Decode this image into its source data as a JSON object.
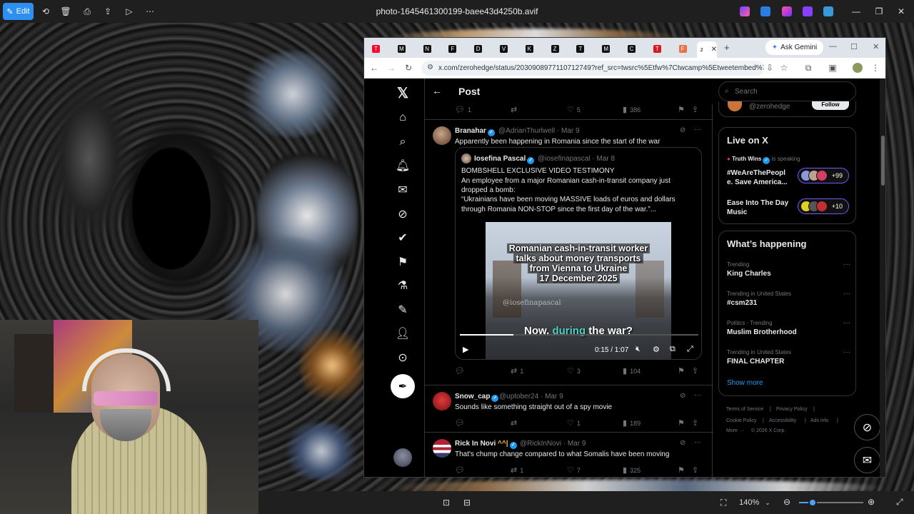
{
  "photos_app": {
    "edit_label": "Edit",
    "file_title": "photo-1645461300199-baee43d4250b.avif",
    "zoom_level": "140%"
  },
  "browser": {
    "tabs": [
      {
        "glyph": "T",
        "color": "#ff0033"
      },
      {
        "glyph": "M",
        "color": "#111111"
      },
      {
        "glyph": "N",
        "color": "#111111"
      },
      {
        "glyph": "F",
        "color": "#111111"
      },
      {
        "glyph": "D",
        "color": "#111111"
      },
      {
        "glyph": "V",
        "color": "#111111"
      },
      {
        "glyph": "K",
        "color": "#111111"
      },
      {
        "glyph": "Z",
        "color": "#111111"
      },
      {
        "glyph": "T",
        "color": "#111111"
      },
      {
        "glyph": "M",
        "color": "#111111"
      },
      {
        "glyph": "C",
        "color": "#111111"
      },
      {
        "glyph": "T",
        "color": "#d71920"
      },
      {
        "glyph": "F",
        "color": "#e8704a"
      },
      {
        "glyph": "z",
        "color": "#111111"
      }
    ],
    "gemini_label": "Ask Gemini",
    "url": "x.com/zerohedge/status/2030908977110712749?ref_src=twsrc%5Etfw%7Ctwcamp%5Etweetembed%7Ctwt..."
  },
  "x": {
    "header_title": "Post",
    "prev_actions": {
      "replies": "1",
      "likes": "5",
      "views": "386"
    },
    "tweet1": {
      "name": "Branahar",
      "handle": "@AdrianThurlwell",
      "date": "· Mar 9",
      "text": "Apparently been happening in Romania since the start of the war",
      "quote": {
        "name": "Iosefina Pascal",
        "handle": "@iosefinapascal",
        "date": "· Mar 8",
        "lines": [
          "BOMBSHELL EXCLUSIVE VIDEO TESTIMONY",
          "An employee from a major Romanian cash-in-transit company just",
          "dropped a bomb:",
          "“Ukrainians have been moving MASSIVE loads of euros and dollars",
          "through Romania NON-STOP since the first day of the war.”..."
        ],
        "video": {
          "title_lines": [
            "Romanian cash-in-transit worker",
            "talks about money transports",
            "from Vienna to Ukraine",
            "17 December 2025"
          ],
          "watermark": "@iosefinapascal",
          "caption_pre": "Now,",
          "caption_hl": "during",
          "caption_post": "the war?",
          "time": "0:15 / 1:07",
          "progress": 0.224
        }
      },
      "actions": {
        "retweets": "1",
        "likes": "3",
        "views": "104"
      }
    },
    "tweet2": {
      "name": "Snow_cap",
      "handle": "@uptober24",
      "date": "· Mar 9",
      "text": "Sounds like something straight out of a spy movie",
      "actions": {
        "likes": "1",
        "views": "189"
      }
    },
    "tweet3": {
      "name": "Rick In Novi",
      "name_emoji": "^^|",
      "handle": "@RickInNovi",
      "date": "· Mar 9",
      "text": "That's chump change compared to what Somalis have been moving",
      "actions": {
        "retweets": "1",
        "likes": "7",
        "views": "325"
      }
    },
    "sidebar": {
      "search_placeholder": "Search",
      "follow_handle": "@zerohedge",
      "follow_label": "Follow",
      "live_title": "Live on X",
      "live_host": "Truth Wins",
      "live_status": "is speaking",
      "live_items": [
        {
          "line1": "#WeAreThePeopl",
          "line2": "e. Save America...",
          "count": "+99"
        },
        {
          "line1": "Ease Into The Day",
          "line2": "Music",
          "count": "+10"
        }
      ],
      "happening_title": "What’s happening",
      "trends": [
        {
          "label": "Trending",
          "name": "King Charles"
        },
        {
          "label": "Trending in United States",
          "name": "#csm231"
        },
        {
          "label": "Politics · Trending",
          "name": "Muslim Brotherhood"
        },
        {
          "label": "Trending in United States",
          "name": "FINAL CHAPTER"
        }
      ],
      "show_more": "Show more",
      "footer": [
        "Terms of Service",
        "|",
        "Privacy Policy",
        "|",
        "Cookie Policy",
        "|",
        "Accessibility",
        "|",
        "Ads info",
        "|",
        "More ···",
        "© 2026 X Corp."
      ]
    }
  },
  "colors": {
    "accent": "#1d9bf0",
    "edit_button": "#2d8ff0",
    "live_border": "#7856ff"
  }
}
